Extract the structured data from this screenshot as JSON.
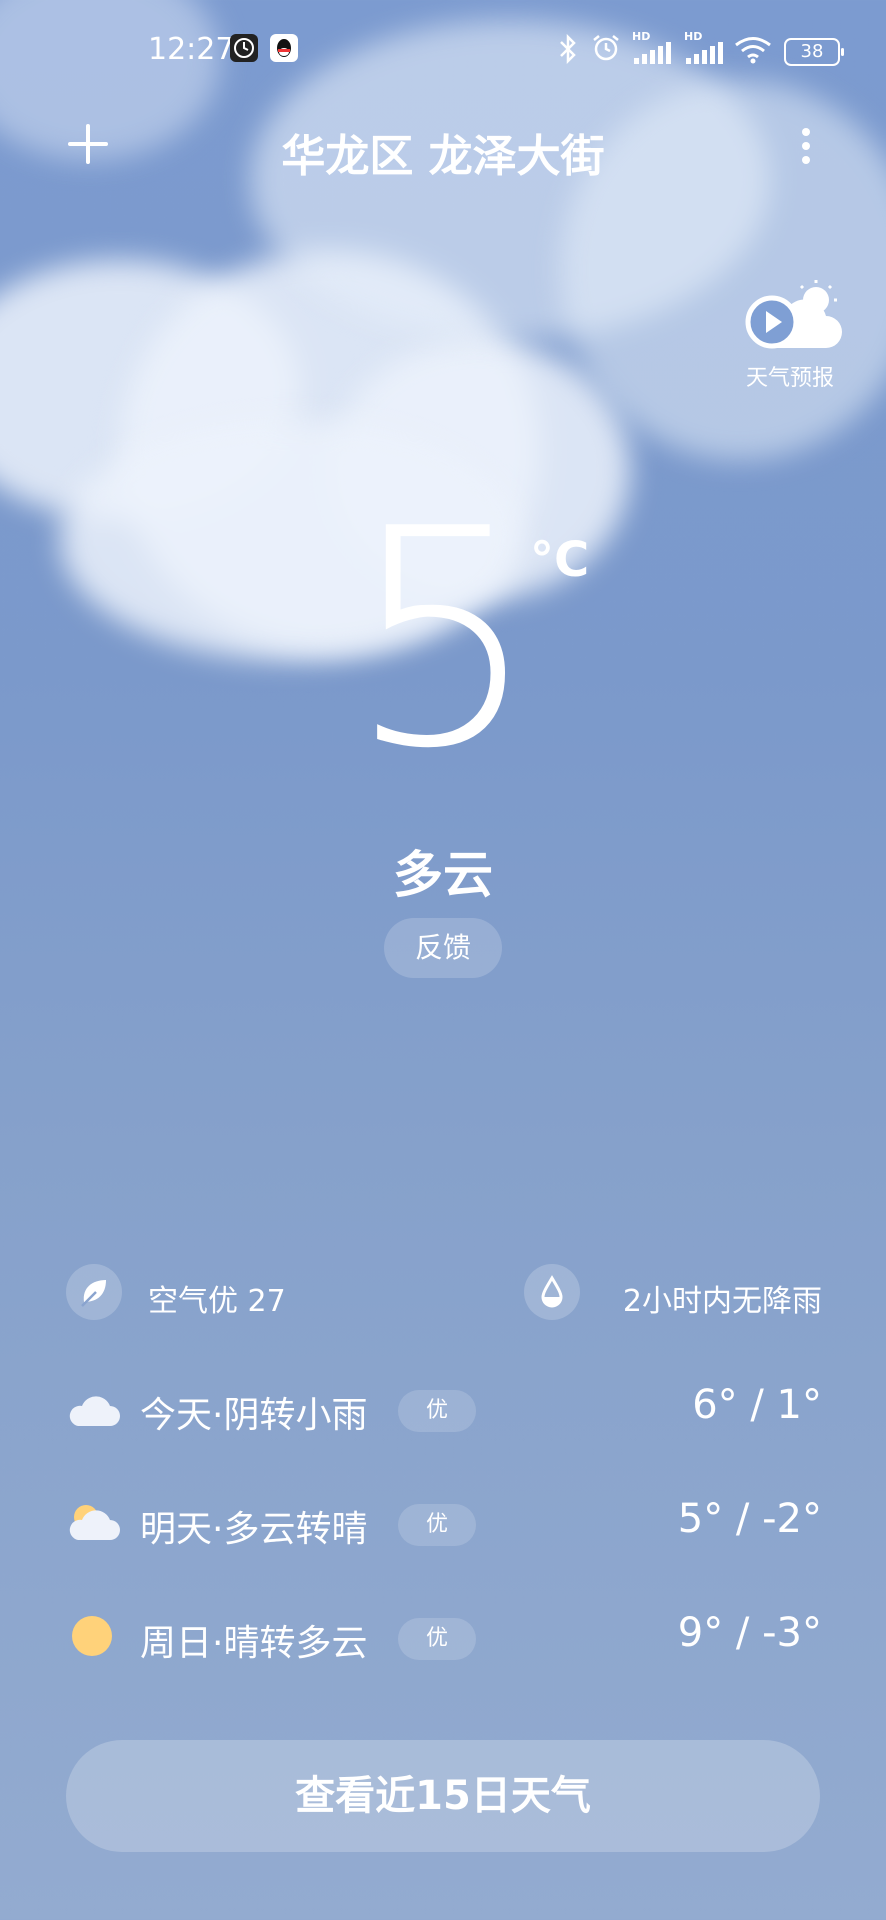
{
  "status_bar": {
    "time": "12:27",
    "battery": "38",
    "signal_labels": [
      "HD",
      "HD"
    ]
  },
  "header": {
    "location": "华龙区 龙泽大街",
    "add_icon": "plus-icon",
    "more_icon": "more-vertical-icon"
  },
  "forecast_video": {
    "label": "天气预报",
    "icon": "play-weather-icon"
  },
  "current": {
    "temperature": "5",
    "unit": "°C",
    "condition": "多云",
    "feedback_label": "反馈"
  },
  "air_quality": {
    "label": "空气优 27",
    "icon": "leaf-icon"
  },
  "precipitation": {
    "label": "2小时内无降雨",
    "icon": "raindrop-icon"
  },
  "daily": [
    {
      "label": "今天·阴转小雨",
      "badge": "优",
      "temps": "6° / 1°",
      "icon": "cloud-icon"
    },
    {
      "label": "明天·多云转晴",
      "badge": "优",
      "temps": "5° / -2°",
      "icon": "partly-cloudy-icon"
    },
    {
      "label": "周日·晴转多云",
      "badge": "优",
      "temps": "9° / -3°",
      "icon": "sun-icon"
    }
  ],
  "cta_label": "查看近15日天气",
  "colors": {
    "sky_top": "#7c9bd0",
    "sky_bottom": "#93abd0",
    "sun": "#ffd27a"
  }
}
